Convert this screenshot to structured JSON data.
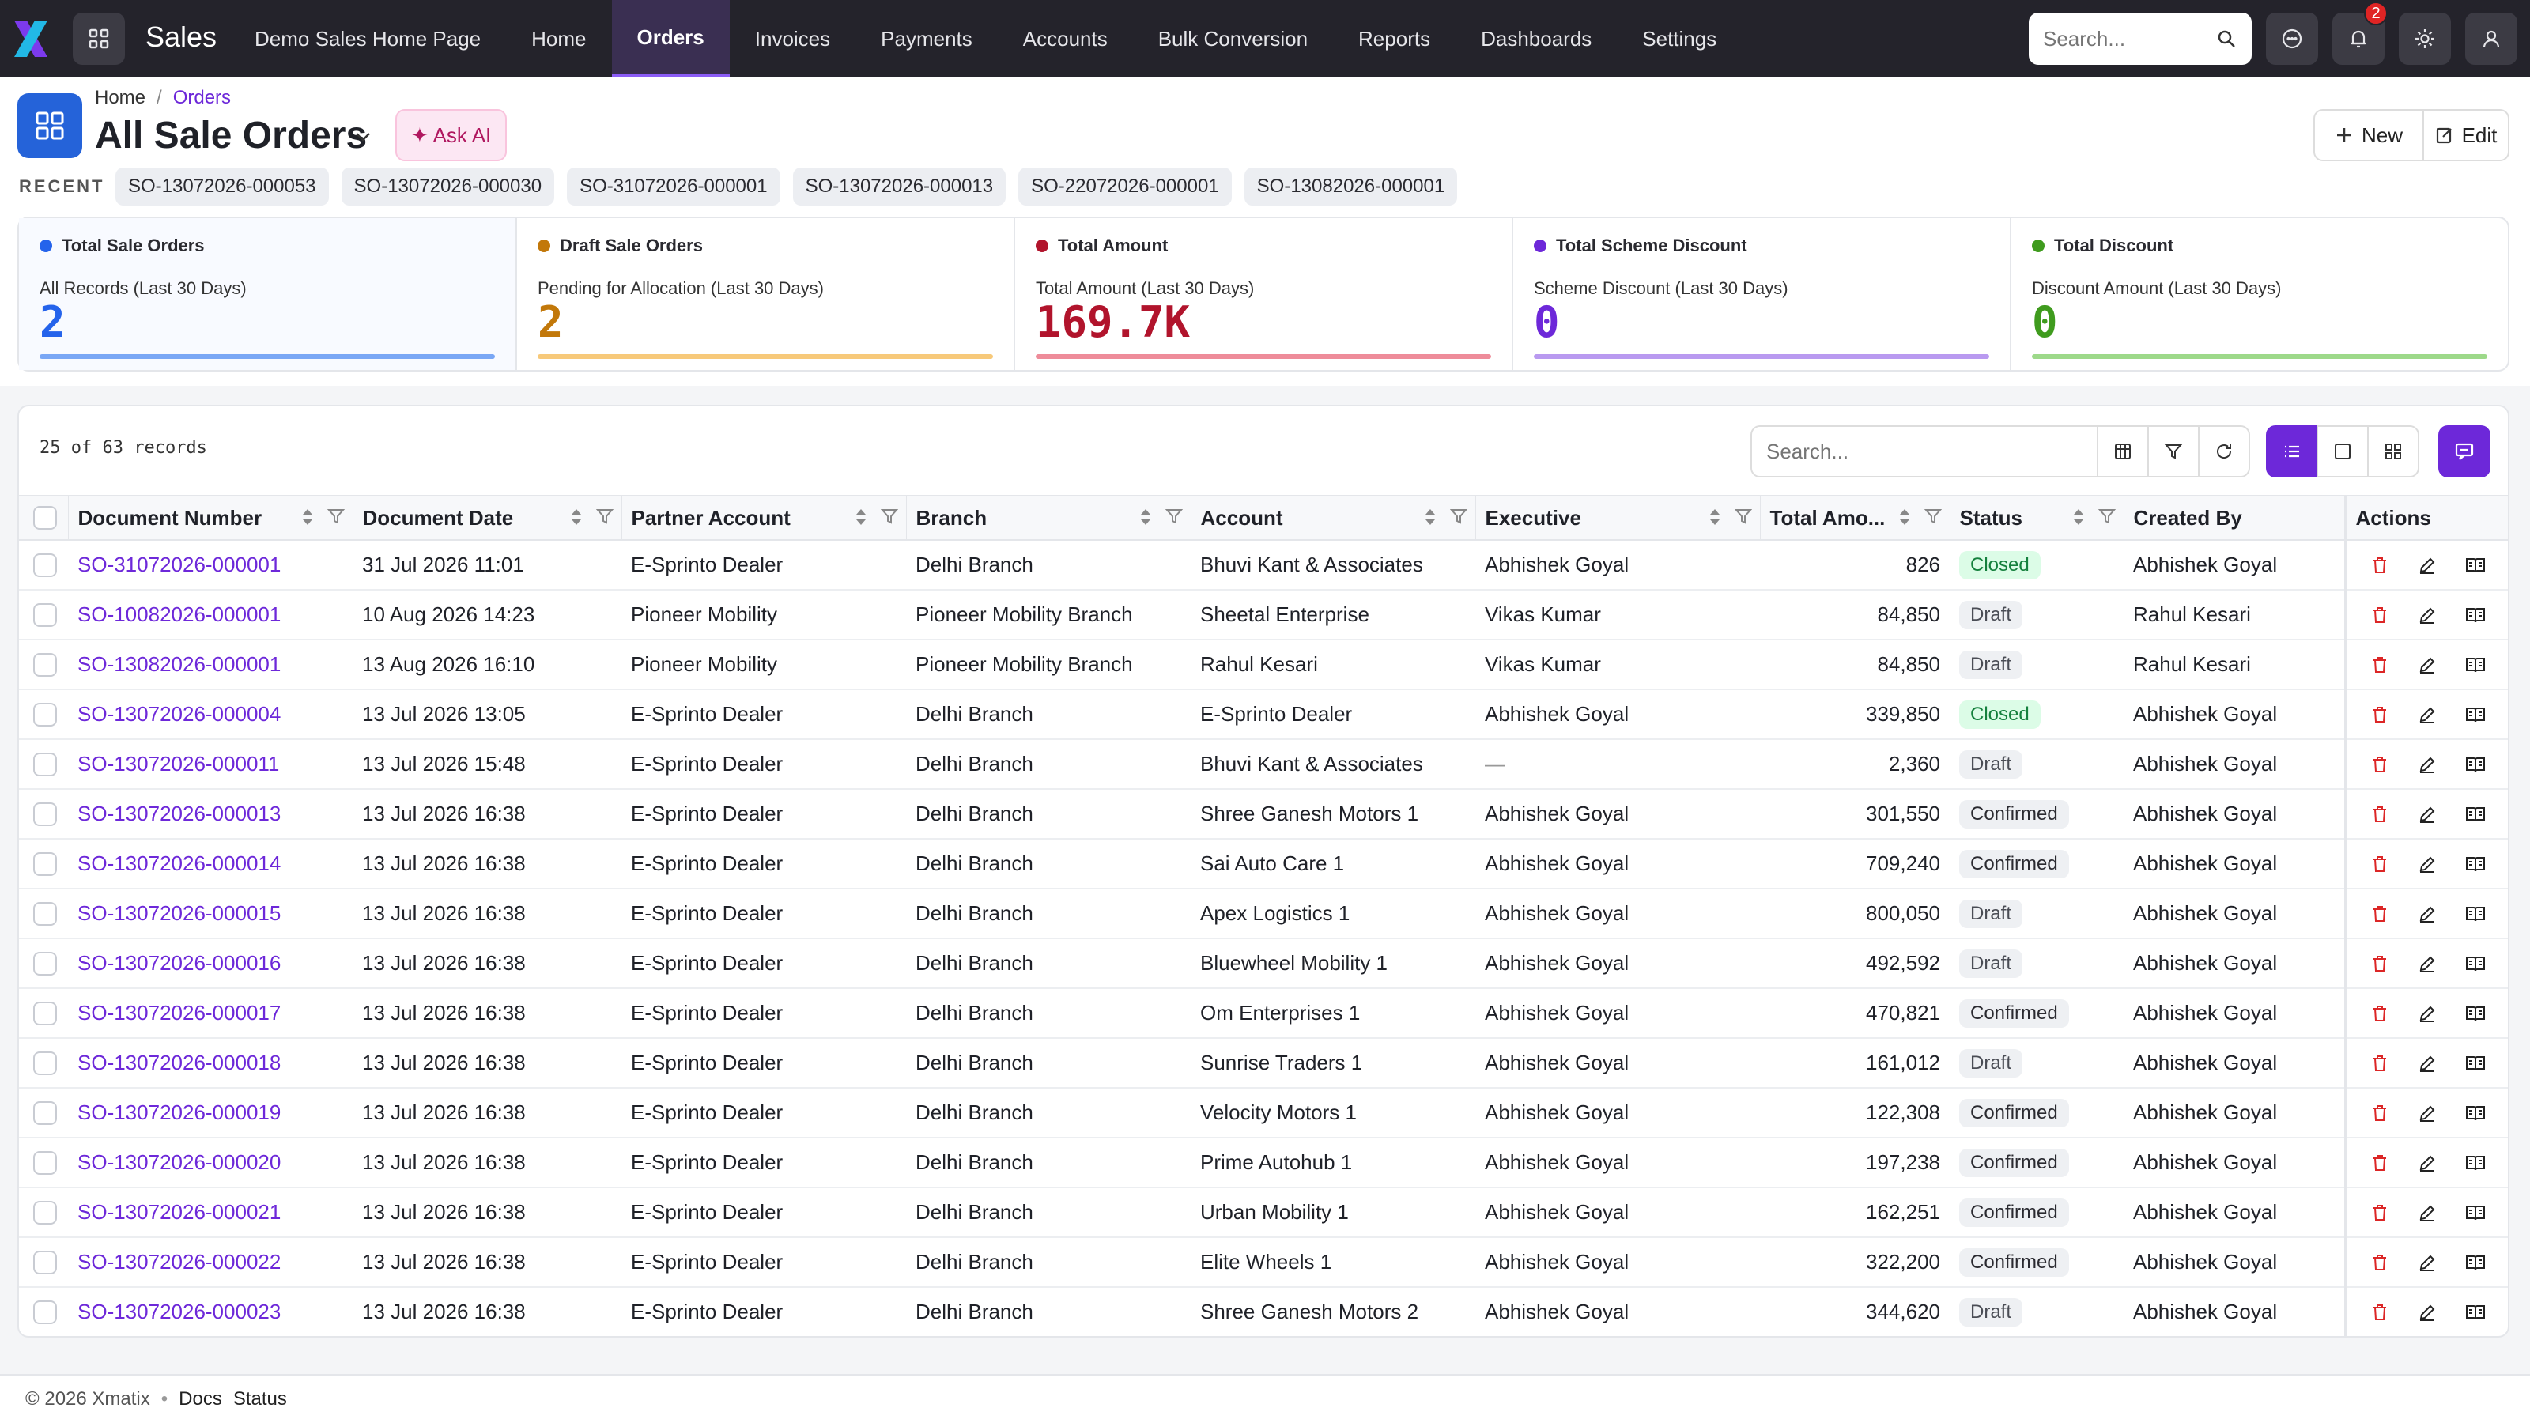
{
  "app": {
    "name": "Sales"
  },
  "nav": [
    {
      "label": "Demo Sales Home Page"
    },
    {
      "label": "Home"
    },
    {
      "label": "Orders",
      "active": true
    },
    {
      "label": "Invoices"
    },
    {
      "label": "Payments"
    },
    {
      "label": "Accounts"
    },
    {
      "label": "Bulk Conversion"
    },
    {
      "label": "Reports"
    },
    {
      "label": "Dashboards"
    },
    {
      "label": "Settings"
    }
  ],
  "topbar": {
    "search_placeholder": "Search...",
    "notification_count": "2"
  },
  "breadcrumb": {
    "home": "Home",
    "sep": "/",
    "current": "Orders"
  },
  "page": {
    "title": "All Sale Orders",
    "ask_ai": "✦ Ask AI",
    "new_label": "New",
    "edit_label": "Edit"
  },
  "recent": {
    "label": "RECENT",
    "items": [
      "SO-13072026-000053",
      "SO-13072026-000030",
      "SO-31072026-000001",
      "SO-13072026-000013",
      "SO-22072026-000001",
      "SO-13082026-000001"
    ]
  },
  "stats": [
    {
      "label": "Total Sale Orders",
      "sub": "All Records (Last 30 Days)",
      "value": "2",
      "color": "#2563eb",
      "bar": "#7aa7f5"
    },
    {
      "label": "Draft Sale Orders",
      "sub": "Pending for Allocation (Last 30 Days)",
      "value": "2",
      "color": "#c2780a",
      "bar": "#f7c97a"
    },
    {
      "label": "Total Amount",
      "sub": "Total Amount (Last 30 Days)",
      "value": "169.7K",
      "color": "#b1142c",
      "bar": "#ee8c9a"
    },
    {
      "label": "Total Scheme Discount",
      "sub": "Scheme Discount (Last 30 Days)",
      "value": "0",
      "color": "#6d28d9",
      "bar": "#b99af0"
    },
    {
      "label": "Total Discount",
      "sub": "Discount Amount (Last 30 Days)",
      "value": "0",
      "color": "#3f9b1e",
      "bar": "#9dd98a"
    }
  ],
  "table": {
    "records_text": "25 of 63 records",
    "search_placeholder": "Search...",
    "columns": [
      "Document Number",
      "Document Date",
      "Partner Account",
      "Branch",
      "Account",
      "Executive",
      "Total Amo...",
      "Status",
      "Created By",
      "Actions"
    ],
    "rows": [
      {
        "doc": "SO-31072026-000001",
        "date": "31 Jul 2026 11:01",
        "partner": "E-Sprinto Dealer",
        "branch": "Delhi Branch",
        "account": "Bhuvi Kant & Associates",
        "exec": "Abhishek Goyal",
        "amount": "826",
        "status": "Closed",
        "created": "Abhishek Goyal"
      },
      {
        "doc": "SO-10082026-000001",
        "date": "10 Aug 2026 14:23",
        "partner": "Pioneer Mobility",
        "branch": "Pioneer Mobility Branch",
        "account": "Sheetal Enterprise",
        "exec": "Vikas Kumar",
        "amount": "84,850",
        "status": "Draft",
        "created": "Rahul Kesari"
      },
      {
        "doc": "SO-13082026-000001",
        "date": "13 Aug 2026 16:10",
        "partner": "Pioneer Mobility",
        "branch": "Pioneer Mobility Branch",
        "account": "Rahul Kesari",
        "exec": "Vikas Kumar",
        "amount": "84,850",
        "status": "Draft",
        "created": "Rahul Kesari"
      },
      {
        "doc": "SO-13072026-000004",
        "date": "13 Jul 2026 13:05",
        "partner": "E-Sprinto Dealer",
        "branch": "Delhi Branch",
        "account": "E-Sprinto Dealer",
        "exec": "Abhishek Goyal",
        "amount": "339,850",
        "status": "Closed",
        "created": "Abhishek Goyal"
      },
      {
        "doc": "SO-13072026-000011",
        "date": "13 Jul 2026 15:48",
        "partner": "E-Sprinto Dealer",
        "branch": "Delhi Branch",
        "account": "Bhuvi Kant & Associates",
        "exec": "—",
        "amount": "2,360",
        "status": "Draft",
        "created": "Abhishek Goyal"
      },
      {
        "doc": "SO-13072026-000013",
        "date": "13 Jul 2026 16:38",
        "partner": "E-Sprinto Dealer",
        "branch": "Delhi Branch",
        "account": "Shree Ganesh Motors 1",
        "exec": "Abhishek Goyal",
        "amount": "301,550",
        "status": "Confirmed",
        "created": "Abhishek Goyal"
      },
      {
        "doc": "SO-13072026-000014",
        "date": "13 Jul 2026 16:38",
        "partner": "E-Sprinto Dealer",
        "branch": "Delhi Branch",
        "account": "Sai Auto Care 1",
        "exec": "Abhishek Goyal",
        "amount": "709,240",
        "status": "Confirmed",
        "created": "Abhishek Goyal"
      },
      {
        "doc": "SO-13072026-000015",
        "date": "13 Jul 2026 16:38",
        "partner": "E-Sprinto Dealer",
        "branch": "Delhi Branch",
        "account": "Apex Logistics 1",
        "exec": "Abhishek Goyal",
        "amount": "800,050",
        "status": "Draft",
        "created": "Abhishek Goyal"
      },
      {
        "doc": "SO-13072026-000016",
        "date": "13 Jul 2026 16:38",
        "partner": "E-Sprinto Dealer",
        "branch": "Delhi Branch",
        "account": "Bluewheel Mobility 1",
        "exec": "Abhishek Goyal",
        "amount": "492,592",
        "status": "Draft",
        "created": "Abhishek Goyal"
      },
      {
        "doc": "SO-13072026-000017",
        "date": "13 Jul 2026 16:38",
        "partner": "E-Sprinto Dealer",
        "branch": "Delhi Branch",
        "account": "Om Enterprises 1",
        "exec": "Abhishek Goyal",
        "amount": "470,821",
        "status": "Confirmed",
        "created": "Abhishek Goyal"
      },
      {
        "doc": "SO-13072026-000018",
        "date": "13 Jul 2026 16:38",
        "partner": "E-Sprinto Dealer",
        "branch": "Delhi Branch",
        "account": "Sunrise Traders 1",
        "exec": "Abhishek Goyal",
        "amount": "161,012",
        "status": "Draft",
        "created": "Abhishek Goyal"
      },
      {
        "doc": "SO-13072026-000019",
        "date": "13 Jul 2026 16:38",
        "partner": "E-Sprinto Dealer",
        "branch": "Delhi Branch",
        "account": "Velocity Motors 1",
        "exec": "Abhishek Goyal",
        "amount": "122,308",
        "status": "Confirmed",
        "created": "Abhishek Goyal"
      },
      {
        "doc": "SO-13072026-000020",
        "date": "13 Jul 2026 16:38",
        "partner": "E-Sprinto Dealer",
        "branch": "Delhi Branch",
        "account": "Prime Autohub 1",
        "exec": "Abhishek Goyal",
        "amount": "197,238",
        "status": "Confirmed",
        "created": "Abhishek Goyal"
      },
      {
        "doc": "SO-13072026-000021",
        "date": "13 Jul 2026 16:38",
        "partner": "E-Sprinto Dealer",
        "branch": "Delhi Branch",
        "account": "Urban Mobility 1",
        "exec": "Abhishek Goyal",
        "amount": "162,251",
        "status": "Confirmed",
        "created": "Abhishek Goyal"
      },
      {
        "doc": "SO-13072026-000022",
        "date": "13 Jul 2026 16:38",
        "partner": "E-Sprinto Dealer",
        "branch": "Delhi Branch",
        "account": "Elite Wheels 1",
        "exec": "Abhishek Goyal",
        "amount": "322,200",
        "status": "Confirmed",
        "created": "Abhishek Goyal"
      },
      {
        "doc": "SO-13072026-000023",
        "date": "13 Jul 2026 16:38",
        "partner": "E-Sprinto Dealer",
        "branch": "Delhi Branch",
        "account": "Shree Ganesh Motors 2",
        "exec": "Abhishek Goyal",
        "amount": "344,620",
        "status": "Draft",
        "created": "Abhishek Goyal"
      }
    ]
  },
  "footer": {
    "copyright": "© 2026 Xmatix",
    "bullet": "•",
    "docs": "Docs",
    "status": "Status"
  },
  "colors": {
    "accent": "#6d28d9",
    "topbar": "#24232b",
    "primary_icon": "#2563d9"
  },
  "icons": [
    "x-logo-icon",
    "apps-grid-icon",
    "search-icon",
    "chat-icon",
    "bell-icon",
    "gear-icon",
    "user-icon",
    "trash-icon",
    "pencil-icon",
    "ledger-icon"
  ]
}
